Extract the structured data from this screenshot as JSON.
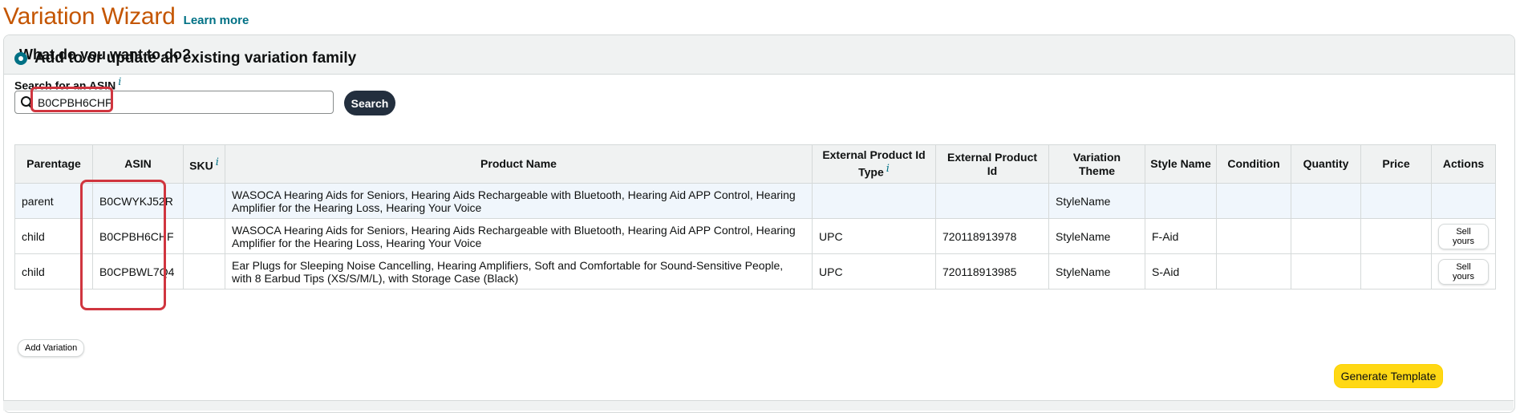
{
  "header": {
    "title": "Variation Wizard",
    "learn_more": "Learn more"
  },
  "panel": {
    "question": "What do you want to do?"
  },
  "option": {
    "label": "Add to or update an existing variation family"
  },
  "search": {
    "label": "Search for an ASIN",
    "info": "i",
    "value": "B0CPBH6CHF",
    "button": "Search"
  },
  "table": {
    "headers": {
      "parentage": "Parentage",
      "asin": "ASIN",
      "sku": "SKU",
      "sku_info": "i",
      "product_name": "Product Name",
      "ext_id_type": "External Product Id Type",
      "ext_id_type_info": "i",
      "ext_id": "External Product Id",
      "variation_theme": "Variation Theme",
      "style_name": "Style Name",
      "condition": "Condition",
      "quantity": "Quantity",
      "price": "Price",
      "actions": "Actions"
    },
    "rows": [
      {
        "parentage": "parent",
        "asin": "B0CWYKJ52R",
        "sku": "",
        "product_name": "WASOCA Hearing Aids for Seniors, Hearing Aids Rechargeable with Bluetooth, Hearing Aid APP Control, Hearing Amplifier for the Hearing Loss, Hearing Your Voice",
        "ext_id_type": "",
        "ext_id": "",
        "variation_theme": "StyleName",
        "style_name": "",
        "condition": "",
        "quantity": "",
        "price": "",
        "action": ""
      },
      {
        "parentage": "child",
        "asin": "B0CPBH6CHF",
        "sku": "",
        "product_name": "WASOCA Hearing Aids for Seniors, Hearing Aids Rechargeable with Bluetooth, Hearing Aid APP Control, Hearing Amplifier for the Hearing Loss, Hearing Your Voice",
        "ext_id_type": "UPC",
        "ext_id": "720118913978",
        "variation_theme": "StyleName",
        "style_name": "F-Aid",
        "condition": "",
        "quantity": "",
        "price": "",
        "action": "Sell yours"
      },
      {
        "parentage": "child",
        "asin": "B0CPBWL7Q4",
        "sku": "",
        "product_name": "Ear Plugs for Sleeping Noise Cancelling, Hearing Amplifiers, Soft and Comfortable for Sound-Sensitive People, with 8 Earbud Tips (XS/S/M/L), with Storage Case (Black)",
        "ext_id_type": "UPC",
        "ext_id": "720118913985",
        "variation_theme": "StyleName",
        "style_name": "S-Aid",
        "condition": "",
        "quantity": "",
        "price": "",
        "action": "Sell yours"
      }
    ]
  },
  "buttons": {
    "add_variation": "Add Variation",
    "generate_template": "Generate Template"
  },
  "colors": {
    "title": "#c45500",
    "link": "#007185",
    "highlight": "#d0353f",
    "primary": "#ffd814",
    "dark_button": "#232f3e"
  }
}
